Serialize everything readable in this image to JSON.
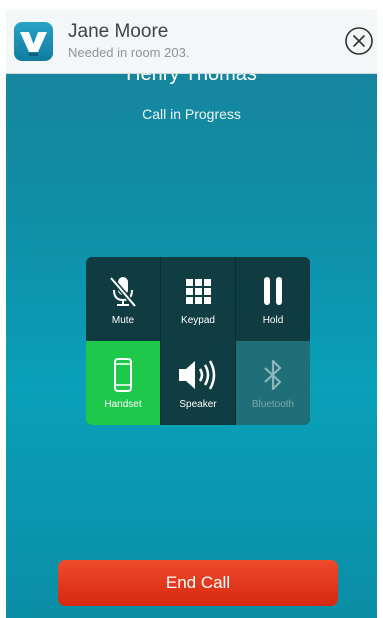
{
  "notification": {
    "title": "Jane Moore",
    "message": "Needed in room 203.",
    "app_icon": "vocera-app-icon",
    "close_icon": "close-circle-icon"
  },
  "call": {
    "caller_name": "Henry Thomas",
    "status": "Call in Progress"
  },
  "controls": [
    {
      "label": "Mute",
      "icon": "mic-muted-icon",
      "state": "off"
    },
    {
      "label": "Keypad",
      "icon": "keypad-icon",
      "state": "off"
    },
    {
      "label": "Hold",
      "icon": "pause-icon",
      "state": "off"
    },
    {
      "label": "Handset",
      "icon": "handset-icon",
      "state": "active"
    },
    {
      "label": "Speaker",
      "icon": "speaker-icon",
      "state": "off"
    },
    {
      "label": "Bluetooth",
      "icon": "bluetooth-icon",
      "state": "disabled"
    }
  ],
  "end_call": {
    "label": "End Call"
  },
  "colors": {
    "background": "#0a9bb4",
    "active": "#1ec84a",
    "end_call": "#e03a1d"
  }
}
